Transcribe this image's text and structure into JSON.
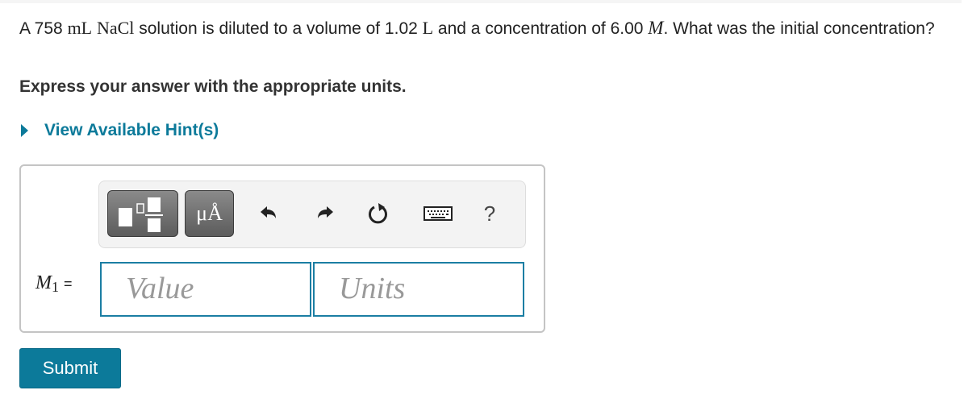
{
  "question": {
    "prefix": "A 758 ",
    "unit_ml": "mL",
    "space1": " ",
    "compound": "NaCl",
    "mid": " solution is diluted to a volume of 1.02 ",
    "unit_l": "L",
    "mid2": " and a concentration of 6.00 ",
    "unit_m": "M",
    "suffix": ". What was the initial concentration?"
  },
  "instruction": "Express your answer with the appropriate units.",
  "hint_link": "View Available Hint(s)",
  "toolbar": {
    "templates_icon": "templates-icon",
    "units_label": "μÅ",
    "undo_icon": "undo-icon",
    "redo_icon": "redo-icon",
    "reset_icon": "reset-icon",
    "keyboard_icon": "keyboard-icon",
    "help_label": "?"
  },
  "answer": {
    "variable": "M",
    "subscript": "1",
    "equals": "=",
    "value_placeholder": "Value",
    "units_placeholder": "Units"
  },
  "submit_label": "Submit"
}
